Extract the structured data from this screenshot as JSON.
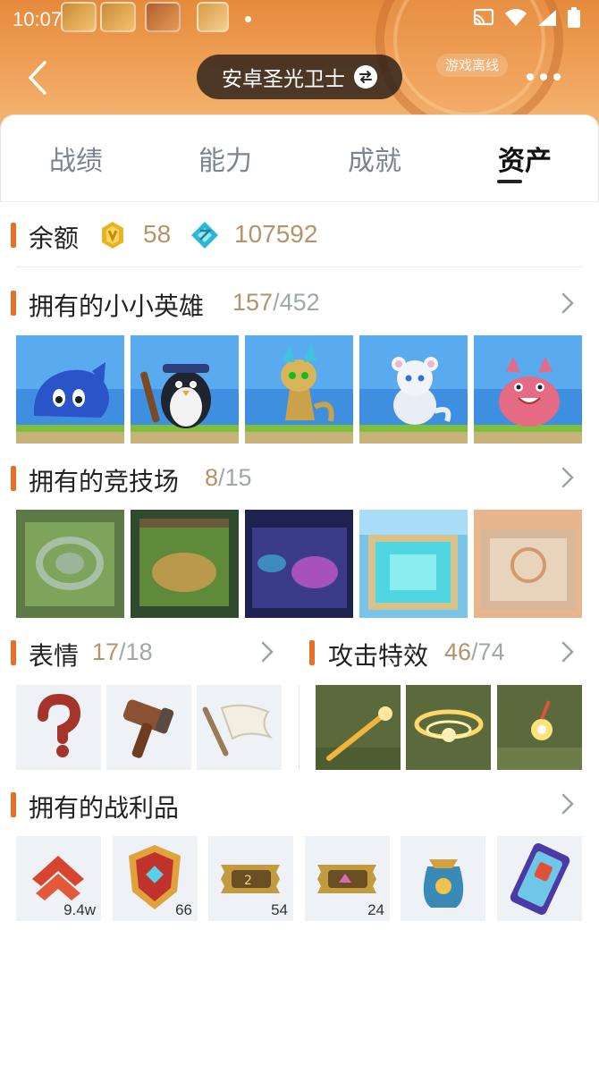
{
  "status_bar": {
    "time": "10:07"
  },
  "header": {
    "title": "安卓圣光卫士",
    "offline_label": "游戏离线"
  },
  "tabs": [
    {
      "label": "战绩",
      "active": false
    },
    {
      "label": "能力",
      "active": false
    },
    {
      "label": "成就",
      "active": false
    },
    {
      "label": "资产",
      "active": true
    }
  ],
  "balance": {
    "label": "余额",
    "coins": "58",
    "gems": "107592"
  },
  "little_legends": {
    "title": "拥有的小小英雄",
    "owned": "157",
    "total": "/452"
  },
  "arenas": {
    "title": "拥有的竞技场",
    "owned": "8",
    "total": "/15"
  },
  "emotes": {
    "title": "表情",
    "owned": "17",
    "total": "/18"
  },
  "attack_effects": {
    "title": "攻击特效",
    "owned": "46",
    "total": "/74"
  },
  "loot": {
    "title": "拥有的战利品",
    "items": [
      {
        "icon": "rank-chevron-icon",
        "count": "9.4w"
      },
      {
        "icon": "red-shield-token-icon",
        "count": "66"
      },
      {
        "icon": "pass-ticket-icon",
        "count": "54"
      },
      {
        "icon": "pass-ticket-plus-icon",
        "count": "24"
      },
      {
        "icon": "treasure-bag-icon",
        "count": ""
      },
      {
        "icon": "card-pack-icon",
        "count": ""
      }
    ]
  },
  "colors": {
    "accent": "#e2722a",
    "count": "#b6926a",
    "header": "#ec9748"
  }
}
